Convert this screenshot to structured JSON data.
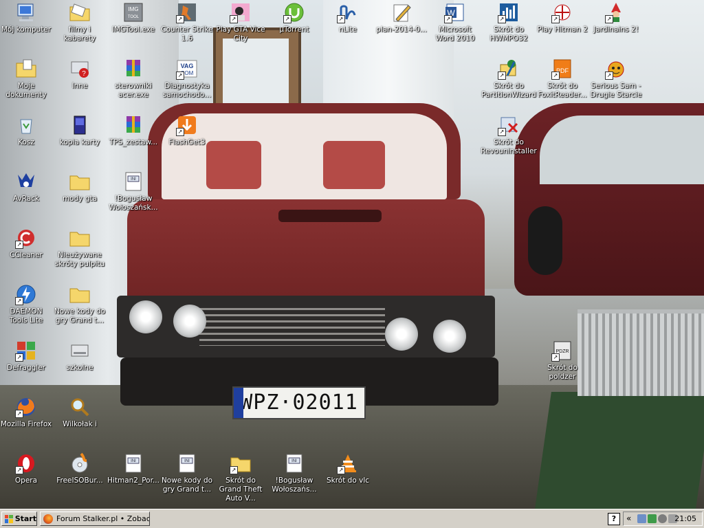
{
  "wallpaper": {
    "plate_text": "WPZ·02011",
    "plate_country": "PL"
  },
  "icons": [
    {
      "name": "computer-icon",
      "label": "Mój komputer",
      "shortcut": false,
      "col": 0,
      "row": 0,
      "kind": "computer"
    },
    {
      "name": "folder-icon",
      "label": "filmy i kabarety",
      "shortcut": false,
      "col": 1,
      "row": 0,
      "kind": "folder-open"
    },
    {
      "name": "imgtool-icon",
      "label": "IMGTool.exe",
      "shortcut": false,
      "col": 2,
      "row": 0,
      "kind": "app-gray"
    },
    {
      "name": "counter-strike-icon",
      "label": "Counter Strike 1.6",
      "shortcut": true,
      "col": 3,
      "row": 0,
      "kind": "cs"
    },
    {
      "name": "gta-vice-city-icon",
      "label": "Play GTA Vice City",
      "shortcut": true,
      "col": 4,
      "row": 0,
      "kind": "pink"
    },
    {
      "name": "utorrent-icon",
      "label": "µTorrent",
      "shortcut": true,
      "col": 5,
      "row": 0,
      "kind": "utorrent"
    },
    {
      "name": "nlite-icon",
      "label": "nLite",
      "shortcut": true,
      "col": 6,
      "row": 0,
      "kind": "nlite"
    },
    {
      "name": "document-icon",
      "label": "plan-2014-0...",
      "shortcut": false,
      "col": 7,
      "row": 0,
      "kind": "pen"
    },
    {
      "name": "word-icon",
      "label": "Microsoft Word 2010",
      "shortcut": true,
      "col": 8,
      "row": 0,
      "kind": "word"
    },
    {
      "name": "hwmonitor-icon",
      "label": "Skrót do HWMPO32",
      "shortcut": true,
      "col": 9,
      "row": 0,
      "kind": "hw"
    },
    {
      "name": "hitman-icon",
      "label": "Play Hitman 2",
      "shortcut": true,
      "col": 10,
      "row": 0,
      "kind": "hitman"
    },
    {
      "name": "jardinains-icon",
      "label": "Jardinains 2!",
      "shortcut": true,
      "col": 11,
      "row": 0,
      "kind": "gnome"
    },
    {
      "name": "my-documents-icon",
      "label": "Moje dokumenty",
      "shortcut": false,
      "col": 0,
      "row": 1,
      "kind": "folder-doc"
    },
    {
      "name": "unknown-app-icon",
      "label": "Inne",
      "shortcut": false,
      "col": 1,
      "row": 1,
      "kind": "question"
    },
    {
      "name": "winrar-icon",
      "label": "sterowniki acer.exe",
      "shortcut": false,
      "col": 2,
      "row": 1,
      "kind": "rar"
    },
    {
      "name": "vag-com-icon",
      "label": "Diagnostyka samochodo...",
      "shortcut": true,
      "col": 3,
      "row": 1,
      "kind": "vag"
    },
    {
      "name": "partition-wizard-icon",
      "label": "Skrót do PartitionWizard",
      "shortcut": true,
      "col": 9,
      "row": 1,
      "kind": "pw"
    },
    {
      "name": "foxit-icon",
      "label": "Skrót do FoxitReader...",
      "shortcut": true,
      "col": 10,
      "row": 1,
      "kind": "pdf"
    },
    {
      "name": "serious-sam-icon",
      "label": "Serious Sam - Drugie Starcie",
      "shortcut": true,
      "col": 11,
      "row": 1,
      "kind": "bomb"
    },
    {
      "name": "recycle-bin-icon",
      "label": "Kosz",
      "shortcut": false,
      "col": 0,
      "row": 2,
      "kind": "bin"
    },
    {
      "name": "memory-card-icon",
      "label": "kopia karty",
      "shortcut": false,
      "col": 1,
      "row": 2,
      "kind": "card"
    },
    {
      "name": "archive-icon",
      "label": "TPS_zestaw...",
      "shortcut": false,
      "col": 2,
      "row": 2,
      "kind": "rar"
    },
    {
      "name": "flashget-icon",
      "label": "FlashGet3",
      "shortcut": true,
      "col": 3,
      "row": 2,
      "kind": "flashget"
    },
    {
      "name": "revo-uninstaller-icon",
      "label": "Skrót do Revouninstaller",
      "shortcut": true,
      "col": 9,
      "row": 2,
      "kind": "revo"
    },
    {
      "name": "avrack-icon",
      "label": "AvRack",
      "shortcut": false,
      "col": 0,
      "row": 3,
      "kind": "avrack"
    },
    {
      "name": "folder-icon",
      "label": "mody gta",
      "shortcut": false,
      "col": 1,
      "row": 3,
      "kind": "folder"
    },
    {
      "name": "ini-file-icon",
      "label": "!Bogusław Wołoszańsk...",
      "shortcut": false,
      "col": 2,
      "row": 3,
      "kind": "ini"
    },
    {
      "name": "ccleaner-icon",
      "label": "CCleaner",
      "shortcut": true,
      "col": 0,
      "row": 4,
      "kind": "ccleaner"
    },
    {
      "name": "folder-icon",
      "label": "Nieużywane skróty pulpitu",
      "shortcut": false,
      "col": 1,
      "row": 4,
      "kind": "folder"
    },
    {
      "name": "daemon-tools-icon",
      "label": "DAEMON Tools Lite",
      "shortcut": true,
      "col": 0,
      "row": 5,
      "kind": "daemon"
    },
    {
      "name": "folder-icon",
      "label": "Nowe kody do gry Grand t...",
      "shortcut": false,
      "col": 1,
      "row": 5,
      "kind": "folder"
    },
    {
      "name": "defraggler-icon",
      "label": "Defraggler",
      "shortcut": true,
      "col": 0,
      "row": 6,
      "kind": "defrag"
    },
    {
      "name": "drive-icon",
      "label": "szkolne",
      "shortcut": false,
      "col": 1,
      "row": 6,
      "kind": "drive"
    },
    {
      "name": "poldzer-icon",
      "label": "Skrót do poldzer",
      "shortcut": true,
      "col": 10,
      "row": 6,
      "kind": "poldzer"
    },
    {
      "name": "firefox-icon",
      "label": "Mozilla Firefox",
      "shortcut": true,
      "col": 0,
      "row": 7,
      "kind": "firefox"
    },
    {
      "name": "search-file-icon",
      "label": "Wilkołak i",
      "shortcut": false,
      "col": 1,
      "row": 7,
      "kind": "magnifier"
    },
    {
      "name": "opera-icon",
      "label": "Opera",
      "shortcut": true,
      "col": 0,
      "row": 8,
      "kind": "opera"
    },
    {
      "name": "freeisoburner-icon",
      "label": "FreeISOBur...",
      "shortcut": false,
      "col": 1,
      "row": 8,
      "kind": "disc"
    },
    {
      "name": "ini-file-icon",
      "label": "Hitman2_Por...",
      "shortcut": false,
      "col": 2,
      "row": 8,
      "kind": "ini"
    },
    {
      "name": "ini-file-icon",
      "label": "Nowe kody do gry Grand t...",
      "shortcut": false,
      "col": 3,
      "row": 8,
      "kind": "ini"
    },
    {
      "name": "folder-icon",
      "label": "Skrót do Grand Theft Auto V...",
      "shortcut": true,
      "col": 4,
      "row": 8,
      "kind": "folder"
    },
    {
      "name": "ini-file-icon",
      "label": "!Bogusław Wołoszańs...",
      "shortcut": false,
      "col": 5,
      "row": 8,
      "kind": "ini"
    },
    {
      "name": "vlc-icon",
      "label": "Skrót do vlc",
      "shortcut": true,
      "col": 6,
      "row": 8,
      "kind": "vlc"
    }
  ],
  "taskbar": {
    "start_label": "Start",
    "task_label": "Forum Stalker.pl • Zobac...",
    "help_label": "?",
    "chevron": "«",
    "clock": "21:05"
  }
}
